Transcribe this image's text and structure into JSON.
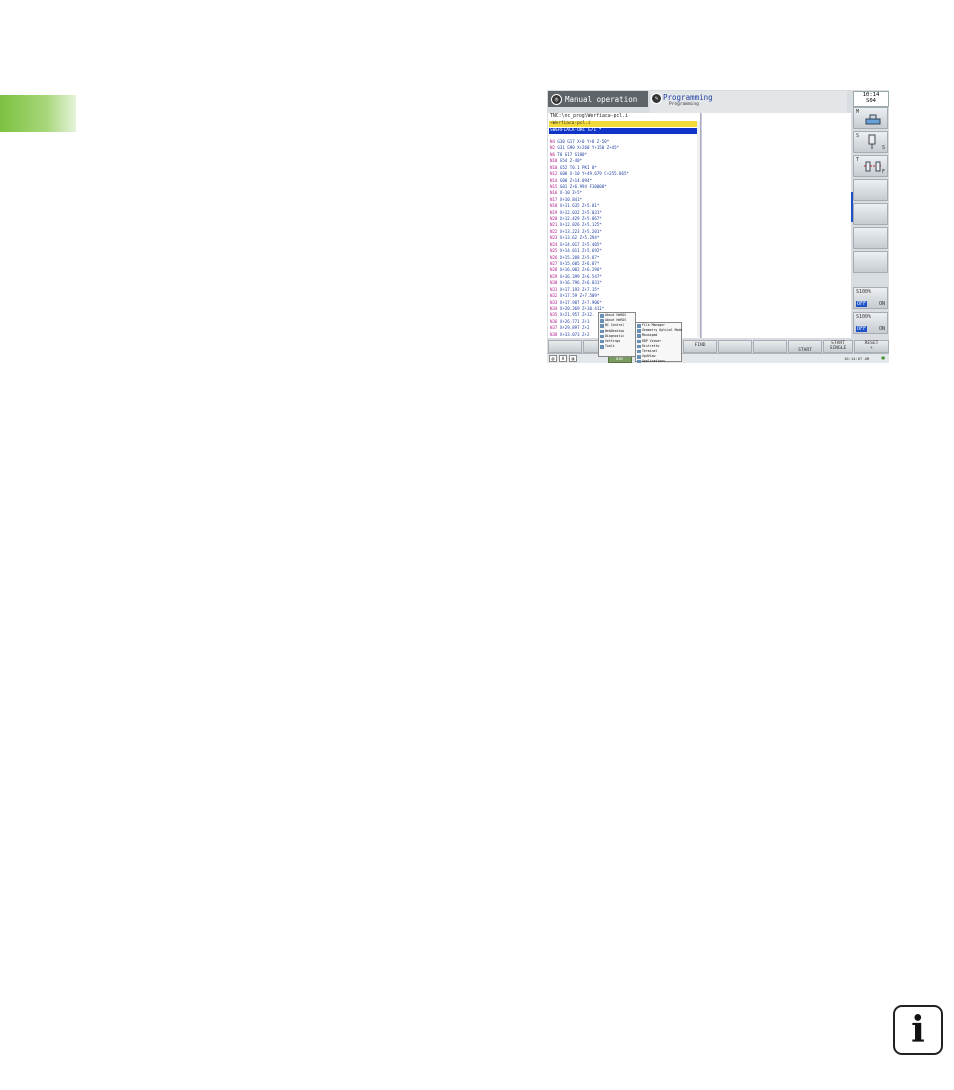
{
  "header": {
    "left_mode": "Manual operation",
    "right_mode": "Programming",
    "right_sub": "Programming",
    "clock_time": "10:14",
    "clock_sub": "S04"
  },
  "program": {
    "path": "TNC:\\nc_prog\\Werfiaca-pcl.i",
    "file_line": "→Werfiaca-pcl.i",
    "selected_line": "SWERFIACA-ORC G71 *",
    "lines": [
      {
        "n": "N4",
        "c": "G30 G17 X+0 Y+0 Z-50*"
      },
      {
        "n": "N2",
        "c": "G31 G90 X+260 Y+150 Z+45*"
      },
      {
        "n": "N6",
        "c": "T0 G17 S100*"
      },
      {
        "n": "N10",
        "c": "G54 Z-40*"
      },
      {
        "n": "N10",
        "c": "G52 T0.1 PKI 0*"
      },
      {
        "n": "N12",
        "c": "G00 X-10 Y+49.679 C+255.865*"
      },
      {
        "n": "N14",
        "c": "G00 Z+14.094*"
      },
      {
        "n": "N15",
        "c": "G01 Z+6.994 F10000*"
      },
      {
        "n": "N16",
        "c": "X-10 Z+5*"
      },
      {
        "n": "N17",
        "c": "X+10.841*"
      },
      {
        "n": "N18",
        "c": "X+11.635 Z+5.01*"
      },
      {
        "n": "N19",
        "c": "X+12.032 Z+5.031*"
      },
      {
        "n": "N20",
        "c": "X+12.429 Z+5.067*"
      },
      {
        "n": "N21",
        "c": "X+12.826 Z+5.125*"
      },
      {
        "n": "N22",
        "c": "X+13.223 Z+5.201*"
      },
      {
        "n": "N23",
        "c": "X+13.62 Z+5.294*"
      },
      {
        "n": "N24",
        "c": "X+14.017 Z+5.405*"
      },
      {
        "n": "N25",
        "c": "X+14.811 Z+5.692*"
      },
      {
        "n": "N26",
        "c": "X+15.208 Z+5.87*"
      },
      {
        "n": "N27",
        "c": "X+15.605 Z+6.07*"
      },
      {
        "n": "N28",
        "c": "X+16.002 Z+6.296*"
      },
      {
        "n": "N29",
        "c": "X+16.399 Z+6.547*"
      },
      {
        "n": "N30",
        "c": "X+16.796 Z+6.831*"
      },
      {
        "n": "N31",
        "c": "X+17.193 Z+7.15*"
      },
      {
        "n": "N32",
        "c": "X+17.59 Z+7.509*"
      },
      {
        "n": "N33",
        "c": "X+17.987 Z+7.906*"
      },
      {
        "n": "N34",
        "c": "X+20.369 Z+10.411*"
      },
      {
        "n": "N35",
        "c": "X+21.957 Z+12."
      },
      {
        "n": "N36",
        "c": "X+26.771 Z+1"
      },
      {
        "n": "N37",
        "c": "X+29.897 Z+2"
      },
      {
        "n": "N38",
        "c": "X+33.073 Z+2"
      }
    ]
  },
  "right_panel": {
    "btn1": "M",
    "btn2a": "S",
    "btn2b": "S",
    "btn3a": "T",
    "btn3b": "F",
    "btn_s100a": "S100%",
    "btn_s100a_off": "OFF",
    "btn_s100a_on": "ON",
    "btn_s100b": "S100%",
    "btn_s100b_off": "OFF",
    "btn_s100b_on": "ON"
  },
  "softkeys": {
    "find": "FIND",
    "start": "START",
    "start_single_a": "START",
    "start_single_b": "SINGLE",
    "reset_a": "RESET",
    "reset_b": "+"
  },
  "start_menu": {
    "items": [
      "About HeROS",
      "About HeROS",
      "NC Control",
      "WebDesktop",
      "Diagnostic",
      "Settings",
      "Tools"
    ],
    "submenu": [
      "File Manager",
      "Geometry Optical Mode",
      "Mousepad",
      "RDP Viewer",
      "Ristretto",
      "Terminal",
      "XpdView",
      "Applications"
    ]
  },
  "taskbar": {
    "start_label": "DIN",
    "time": "10:14:07 AM",
    "icons": [
      "▤",
      "A",
      "▥"
    ]
  },
  "info_icon_glyph": "i"
}
